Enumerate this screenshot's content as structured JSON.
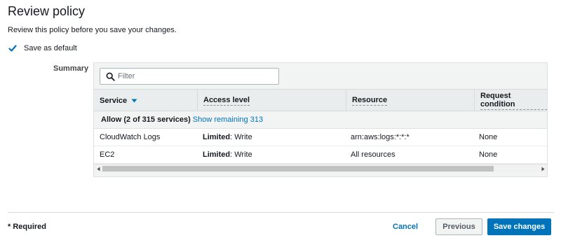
{
  "page": {
    "title": "Review policy",
    "subtitle": "Review this policy before you save your changes."
  },
  "save_default": {
    "label": "Save as default",
    "checked": true
  },
  "summary": {
    "label": "Summary",
    "filter": {
      "placeholder": "Filter",
      "value": ""
    },
    "columns": [
      "Service",
      "Access level",
      "Resource",
      "Request condition"
    ],
    "sorted_column": "Service",
    "group": {
      "label": "Allow (2 of 315 services)",
      "link": "Show remaining 313"
    },
    "rows": [
      {
        "service": "CloudWatch Logs",
        "access_strong": "Limited",
        "access_rest": ": Write",
        "resource": "arn:aws:logs:*:*:*",
        "condition": "None"
      },
      {
        "service": "EC2",
        "access_strong": "Limited",
        "access_rest": ": Write",
        "resource": "All resources",
        "condition": "None"
      }
    ]
  },
  "footer": {
    "required_note": "* Required",
    "cancel_label": "Cancel",
    "previous_label": "Previous",
    "save_label": "Save changes"
  },
  "colors": {
    "link": "#0073bb",
    "primary_button": "#0073bb",
    "header_bg": "#eaeded"
  },
  "icons": {
    "checkbox": "checkmark-icon",
    "filter": "search-icon",
    "sort": "caret-down-icon"
  }
}
